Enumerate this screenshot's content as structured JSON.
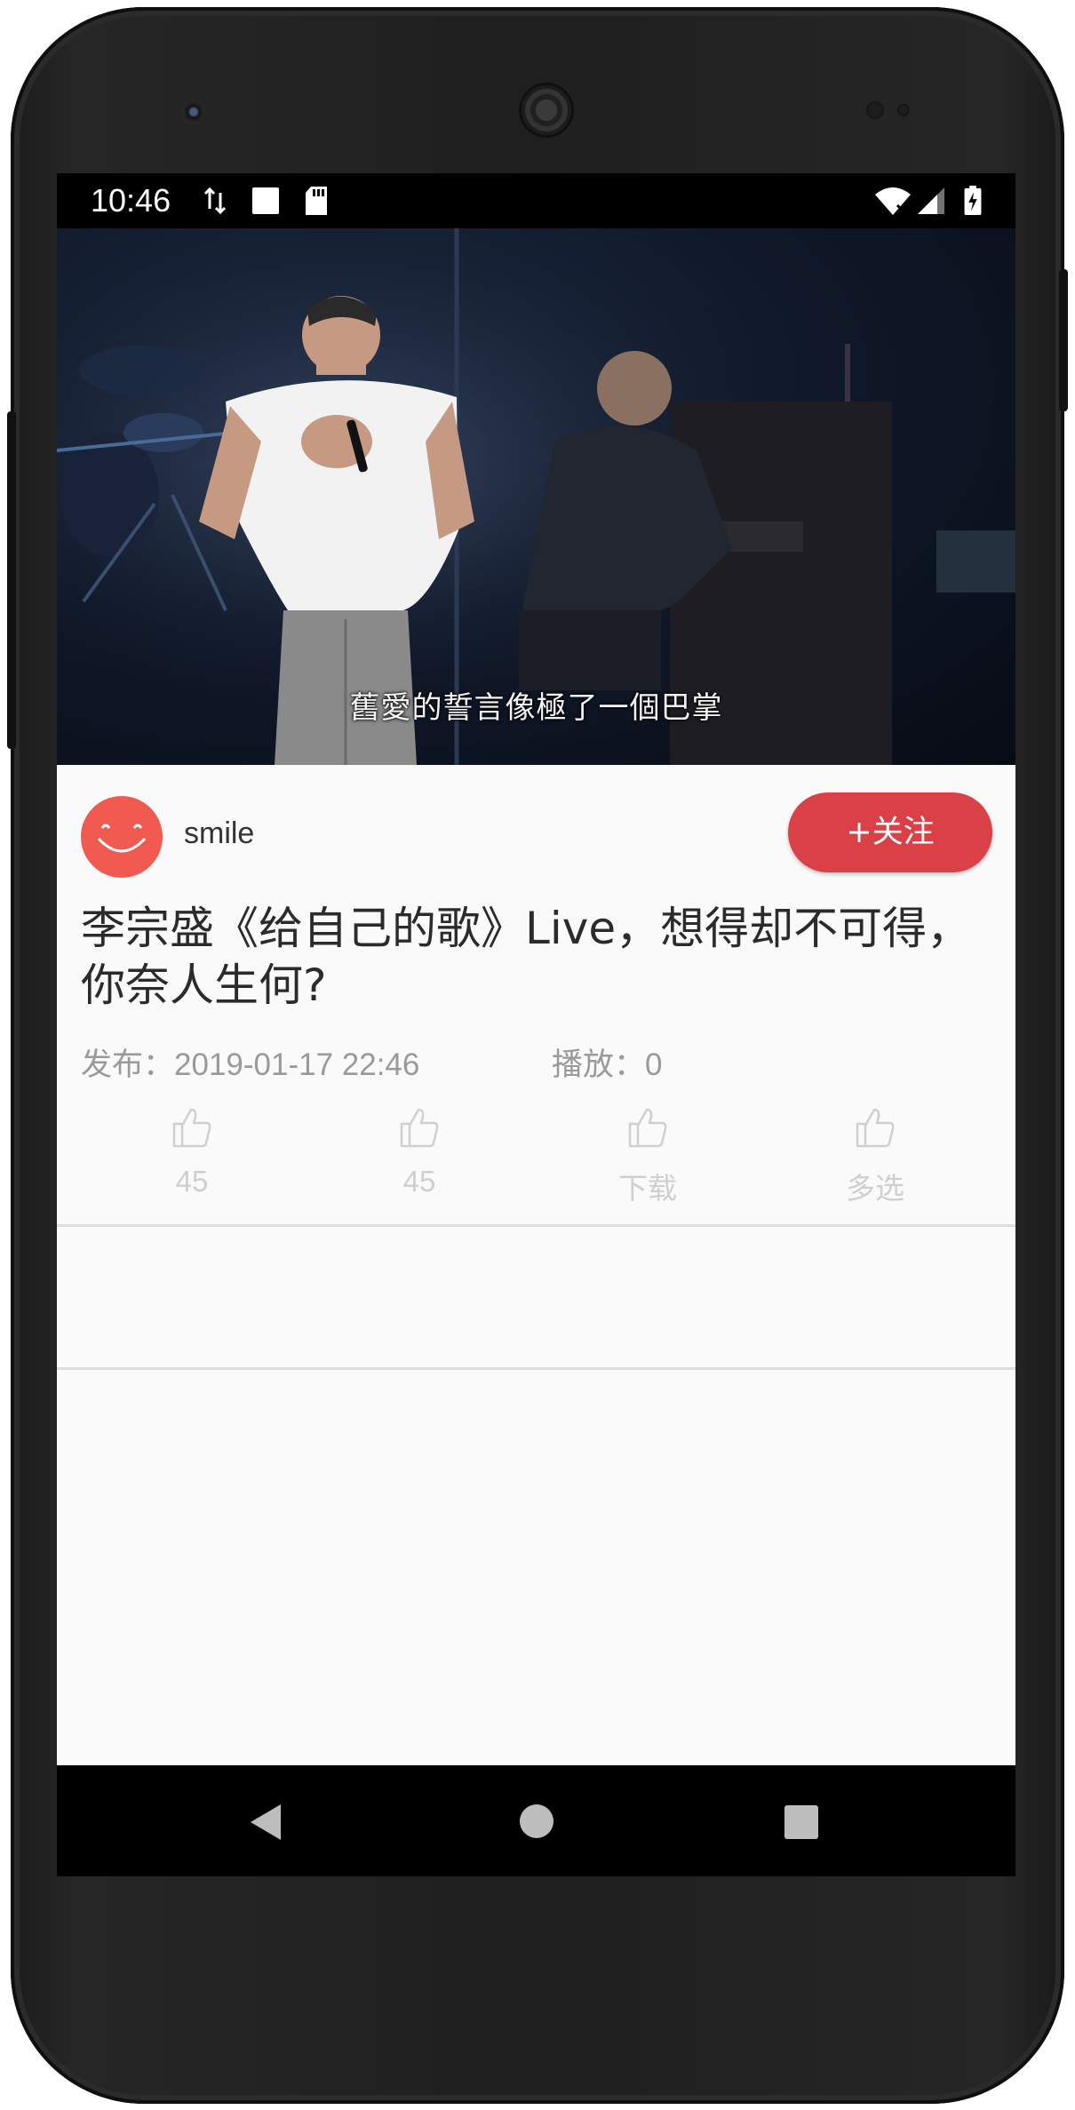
{
  "status_bar": {
    "time": "10:46",
    "icons": [
      "data-transfer-icon",
      "square-notification-icon",
      "sd-card-icon",
      "wifi-icon",
      "signal-icon",
      "battery-charging-icon"
    ]
  },
  "video": {
    "subtitle": "舊愛的誓言像極了一個巴掌"
  },
  "author": {
    "name": "smile",
    "follow_label": "+关注"
  },
  "post": {
    "title": "李宗盛《给自己的歌》Live，想得却不可得，你奈人生何?",
    "publish_label": "发布：",
    "publish_date": "2019-01-17 22:46",
    "plays_label": "播放：",
    "plays": "0"
  },
  "actions": [
    {
      "icon": "thumbs-up-icon",
      "label": "45"
    },
    {
      "icon": "thumbs-up-icon",
      "label": "45"
    },
    {
      "icon": "thumbs-up-icon",
      "label": "下载"
    },
    {
      "icon": "thumbs-up-icon",
      "label": "多选"
    }
  ],
  "colors": {
    "accent": "#d94146",
    "avatar": "#f05a50",
    "muted_text": "#9a9a9a",
    "action_text": "#cfcfcf"
  }
}
